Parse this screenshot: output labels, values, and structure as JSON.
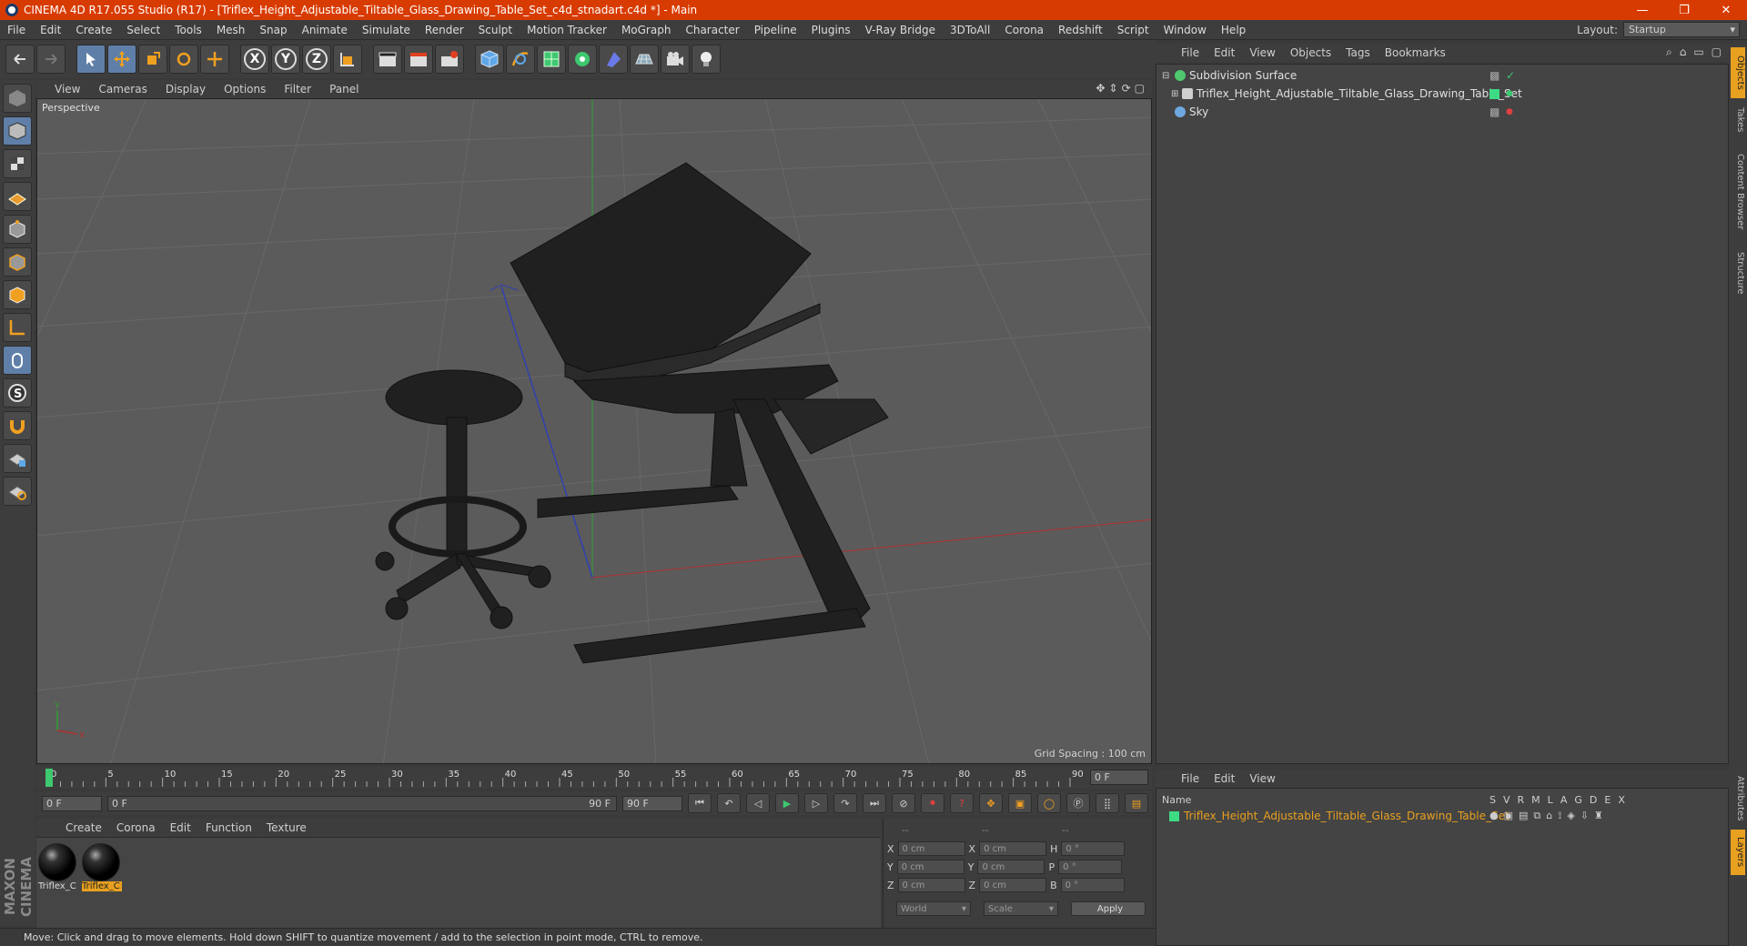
{
  "window": {
    "title": "CINEMA 4D R17.055 Studio (R17) - [Triflex_Height_Adjustable_Tiltable_Glass_Drawing_Table_Set_c4d_stnadart.c4d *] - Main",
    "controls": [
      "—",
      "❐",
      "✕"
    ]
  },
  "menubar": {
    "items": [
      "File",
      "Edit",
      "Create",
      "Select",
      "Tools",
      "Mesh",
      "Snap",
      "Animate",
      "Simulate",
      "Render",
      "Sculpt",
      "Motion Tracker",
      "MoGraph",
      "Character",
      "Pipeline",
      "Plugins",
      "V-Ray Bridge",
      "3DToAll",
      "Corona",
      "Redshift",
      "Script",
      "Window",
      "Help"
    ],
    "layout_label": "Layout:",
    "layout_value": "Startup"
  },
  "toolbar": {
    "axis_x": "X",
    "axis_y": "Y",
    "axis_z": "Z"
  },
  "viewport": {
    "menu": [
      "View",
      "Cameras",
      "Display",
      "Options",
      "Filter",
      "Panel"
    ],
    "label": "Perspective",
    "grid_spacing": "Grid Spacing : 100 cm",
    "axis_x": "X",
    "axis_y": "Y"
  },
  "timeline": {
    "ticks": [
      "0",
      "5",
      "10",
      "15",
      "20",
      "25",
      "30",
      "35",
      "40",
      "45",
      "50",
      "55",
      "60",
      "65",
      "70",
      "75",
      "80",
      "85",
      "90"
    ],
    "current_frame": "0 F",
    "playhead_frame": 0
  },
  "transport": {
    "start_field": "0 F",
    "range_start": "0 F",
    "range_end": "90 F",
    "end_field": "90 F"
  },
  "material_manager": {
    "menu": [
      "Create",
      "Corona",
      "Edit",
      "Function",
      "Texture"
    ],
    "materials": [
      {
        "label": "Triflex_C",
        "selected": false
      },
      {
        "label": "Triflex_C",
        "selected": true
      }
    ]
  },
  "coordinates": {
    "header": [
      "--",
      "--",
      "--"
    ],
    "rows": [
      {
        "a": "X",
        "av": "0 cm",
        "b": "X",
        "bv": "0 cm",
        "c": "H",
        "cv": "0 °"
      },
      {
        "a": "Y",
        "av": "0 cm",
        "b": "Y",
        "bv": "0 cm",
        "c": "P",
        "cv": "0 °"
      },
      {
        "a": "Z",
        "av": "0 cm",
        "b": "Z",
        "bv": "0 cm",
        "c": "B",
        "cv": "0 °"
      }
    ],
    "world": "World",
    "scale": "Scale",
    "apply": "Apply"
  },
  "status": "Move: Click and drag to move elements. Hold down SHIFT to quantize movement / add to the selection in point mode, CTRL to remove.",
  "object_manager": {
    "menu": [
      "File",
      "Edit",
      "View",
      "Objects",
      "Tags",
      "Bookmarks"
    ],
    "objects": [
      {
        "name": "Subdivision Surface",
        "indent": 0,
        "icon_color": "#4fc870"
      },
      {
        "name": "Triflex_Height_Adjustable_Tiltable_Glass_Drawing_Table_Set",
        "indent": 1,
        "icon_color": "#cfcfcf",
        "tag_color": "#3ddc84"
      },
      {
        "name": "Sky",
        "indent": 0,
        "icon_color": "#6ea8e0"
      }
    ]
  },
  "layer_manager": {
    "menu": [
      "File",
      "Edit",
      "View"
    ],
    "columns": [
      "Name",
      "S",
      "V",
      "R",
      "M",
      "L",
      "A",
      "G",
      "D",
      "E",
      "X"
    ],
    "layers": [
      {
        "name": "Triflex_Height_Adjustable_Tiltable_Glass_Drawing_Table_Set",
        "color": "#3ddc84"
      }
    ]
  },
  "right_tabs": [
    "Objects",
    "Takes",
    "Content Browser",
    "Structure",
    "Attributes",
    "Layers"
  ],
  "brand": "MAXON CINEMA 4D",
  "colors": {
    "title_bar": "#d83b01",
    "selection": "#e8a020",
    "accent_blue": "#5f7fa8"
  }
}
